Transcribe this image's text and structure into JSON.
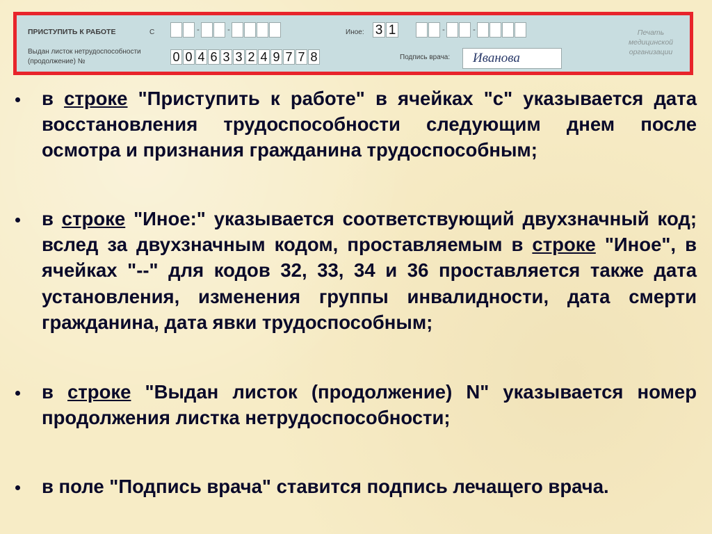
{
  "form": {
    "start_work_label": "ПРИСТУПИТЬ К РАБОТЕ",
    "start_work_from_label": "С",
    "other_label": "Иное:",
    "other_code": [
      "3",
      "1"
    ],
    "issued_label_line1": "Выдан листок нетрудоспособности",
    "issued_label_line2": "(продолжение) №",
    "issued_number": [
      "0",
      "0",
      "4",
      "6",
      "3",
      "3",
      "2",
      "4",
      "9",
      "7",
      "7",
      "8"
    ],
    "doctor_signature_label": "Подпись врача:",
    "doctor_signature_value": "Иванова",
    "stamp_line1": "Печать",
    "stamp_line2": "медицинской",
    "stamp_line3": "организации"
  },
  "bullets": [
    {
      "parts": [
        "в ",
        "строке",
        " \"Приступить к работе\" в ячейках \"с\" указывается дата восстановления трудоспособности следующим днем после осмотра и признания гражданина трудоспособным;"
      ]
    },
    {
      "parts": [
        "в ",
        "строке",
        " \"Иное:\" указывается соответствующий двухзначный код; вслед за двухзначным кодом, проставляемым в ",
        "строке",
        " \"Иное\", в ячейках \"--\" для кодов 32, 33, 34 и 36 проставляется также дата установления, изменения группы инвалидности, дата смерти гражданина, дата явки трудоспособным;"
      ]
    },
    {
      "parts": [
        "в ",
        "строке",
        " \"Выдан листок (продолжение) N\" указывается номер продолжения листка нетрудоспособности;"
      ]
    },
    {
      "parts": [
        "в поле \"Подпись врача\" ставится подпись лечащего врача."
      ]
    }
  ]
}
